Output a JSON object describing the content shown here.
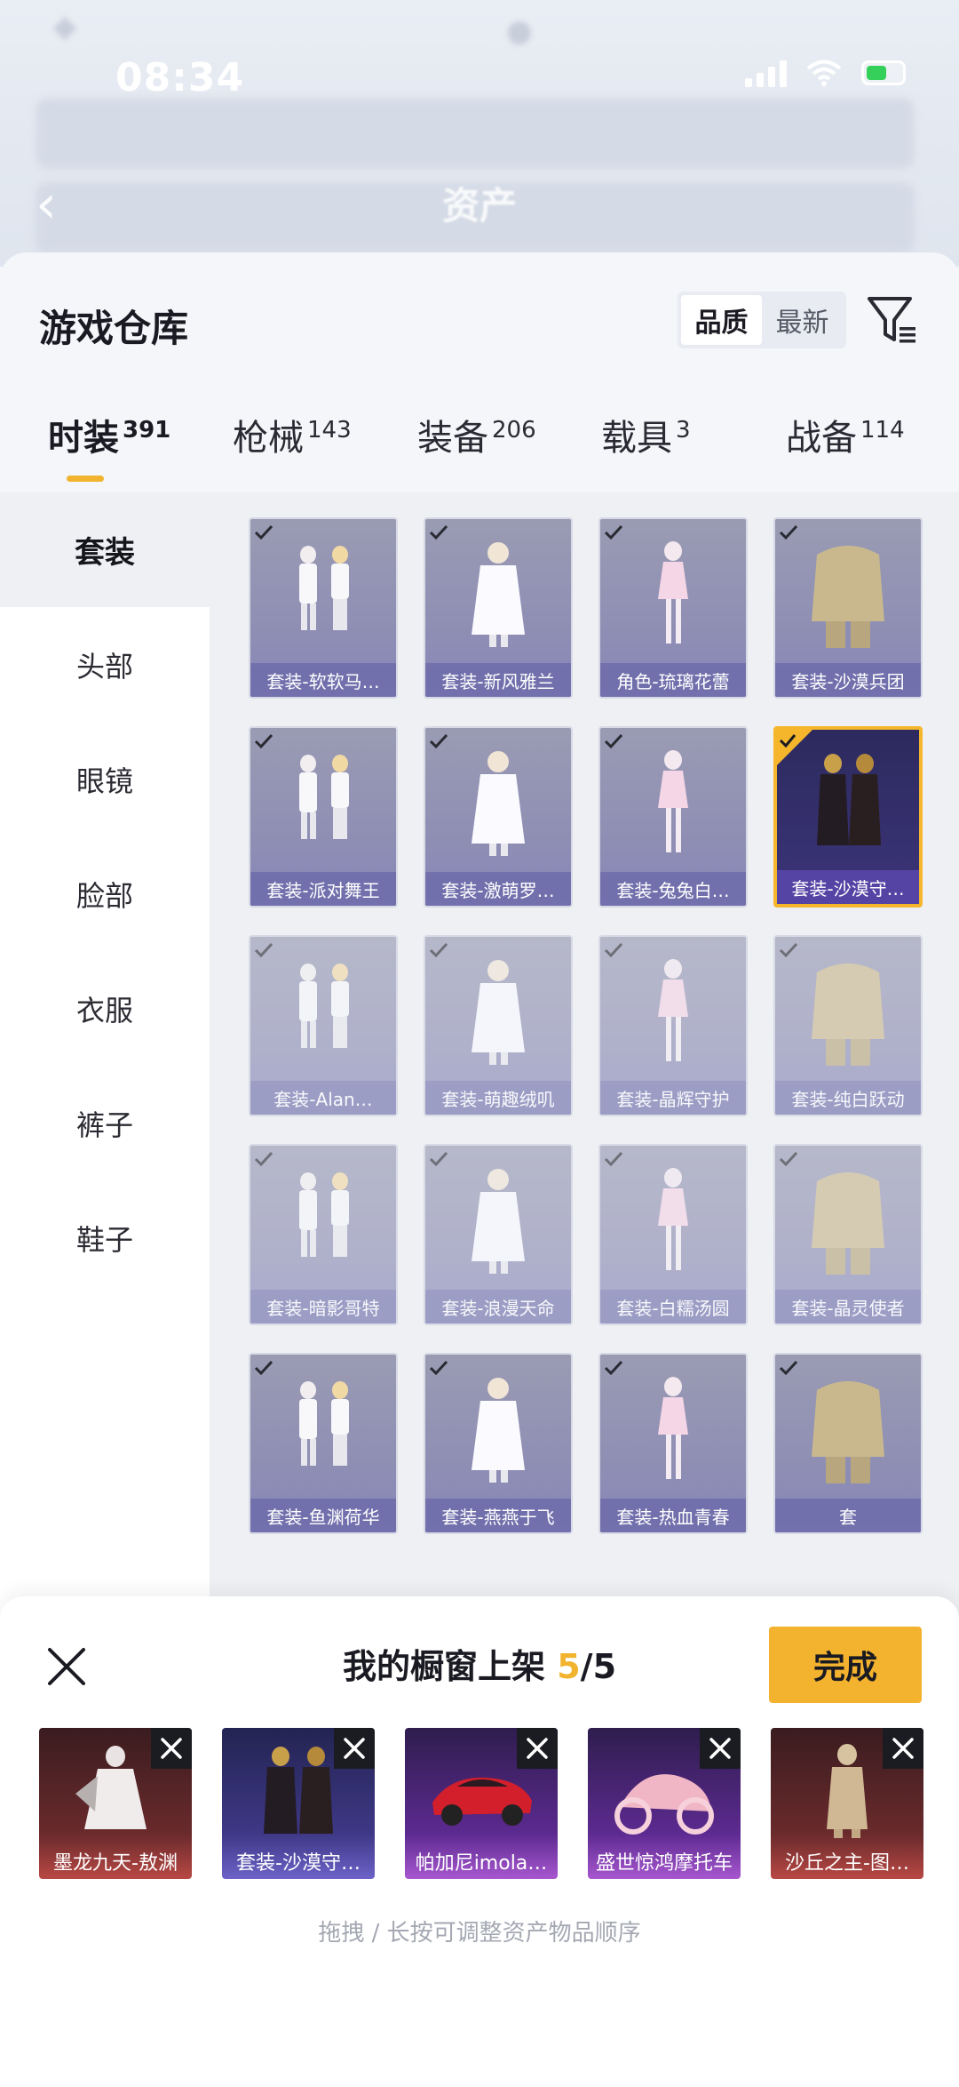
{
  "status_bar": {
    "time": "08:34"
  },
  "background": {
    "title": "资产"
  },
  "sheet": {
    "title": "游戏仓库"
  },
  "sort": {
    "options": [
      "品质",
      "最新"
    ],
    "active": 0
  },
  "tabs": [
    {
      "label": "时装",
      "count": "391",
      "active": true
    },
    {
      "label": "枪械",
      "count": "143",
      "active": false
    },
    {
      "label": "装备",
      "count": "206",
      "active": false
    },
    {
      "label": "载具",
      "count": "3",
      "active": false
    },
    {
      "label": "战备",
      "count": "114",
      "active": false
    }
  ],
  "categories": [
    {
      "label": "套装",
      "active": true
    },
    {
      "label": "头部",
      "active": false
    },
    {
      "label": "眼镜",
      "active": false
    },
    {
      "label": "脸部",
      "active": false
    },
    {
      "label": "衣服",
      "active": false
    },
    {
      "label": "裤子",
      "active": false
    },
    {
      "label": "鞋子",
      "active": false
    }
  ],
  "items": [
    {
      "label": "套装-软软马…",
      "selected": false
    },
    {
      "label": "套装-新风雅兰",
      "selected": false
    },
    {
      "label": "角色-琉璃花蕾",
      "selected": false
    },
    {
      "label": "套装-沙漠兵团",
      "selected": false
    },
    {
      "label": "套装-派对舞王",
      "selected": false
    },
    {
      "label": "套装-激萌罗…",
      "selected": false
    },
    {
      "label": "套装-兔兔白…",
      "selected": false
    },
    {
      "label": "套装-沙漠守…",
      "selected": true
    },
    {
      "label": "套装-Alan…",
      "selected": false
    },
    {
      "label": "套装-萌趣绒叽",
      "selected": false
    },
    {
      "label": "套装-晶辉守护",
      "selected": false
    },
    {
      "label": "套装-纯白跃动",
      "selected": false
    },
    {
      "label": "套装-暗影哥特",
      "selected": false
    },
    {
      "label": "套装-浪漫天命",
      "selected": false
    },
    {
      "label": "套装-白糯汤圆",
      "selected": false
    },
    {
      "label": "套装-晶灵使者",
      "selected": false
    },
    {
      "label": "套装-鱼渊荷华",
      "selected": false
    },
    {
      "label": "套装-燕燕于飞",
      "selected": false
    },
    {
      "label": "套装-热血青春",
      "selected": false
    },
    {
      "label": "套",
      "selected": false
    }
  ],
  "panel": {
    "title": "我的橱窗上架",
    "current": "5",
    "sep": "/",
    "total": "5",
    "done_label": "完成",
    "hint": "拖拽 / 长按可调整资产物品顺序",
    "slots": [
      {
        "label": "墨龙九天-敖渊",
        "theme": "red"
      },
      {
        "label": "套装-沙漠守…",
        "theme": "blue"
      },
      {
        "label": "帕加尼imola…",
        "theme": "purple"
      },
      {
        "label": "盛世惊鸿摩托车",
        "theme": "purple"
      },
      {
        "label": "沙丘之主-图…",
        "theme": "red"
      }
    ]
  },
  "colors": {
    "accent": "#f4b32e",
    "card": "#8f8fb4",
    "selected_border": "#f5b62c"
  },
  "icons": [
    "close-icon",
    "filter-icon",
    "share-icon",
    "checkmark-icon",
    "remove-icon",
    "back-icon",
    "wifi-icon",
    "signal-icon",
    "battery-icon"
  ]
}
